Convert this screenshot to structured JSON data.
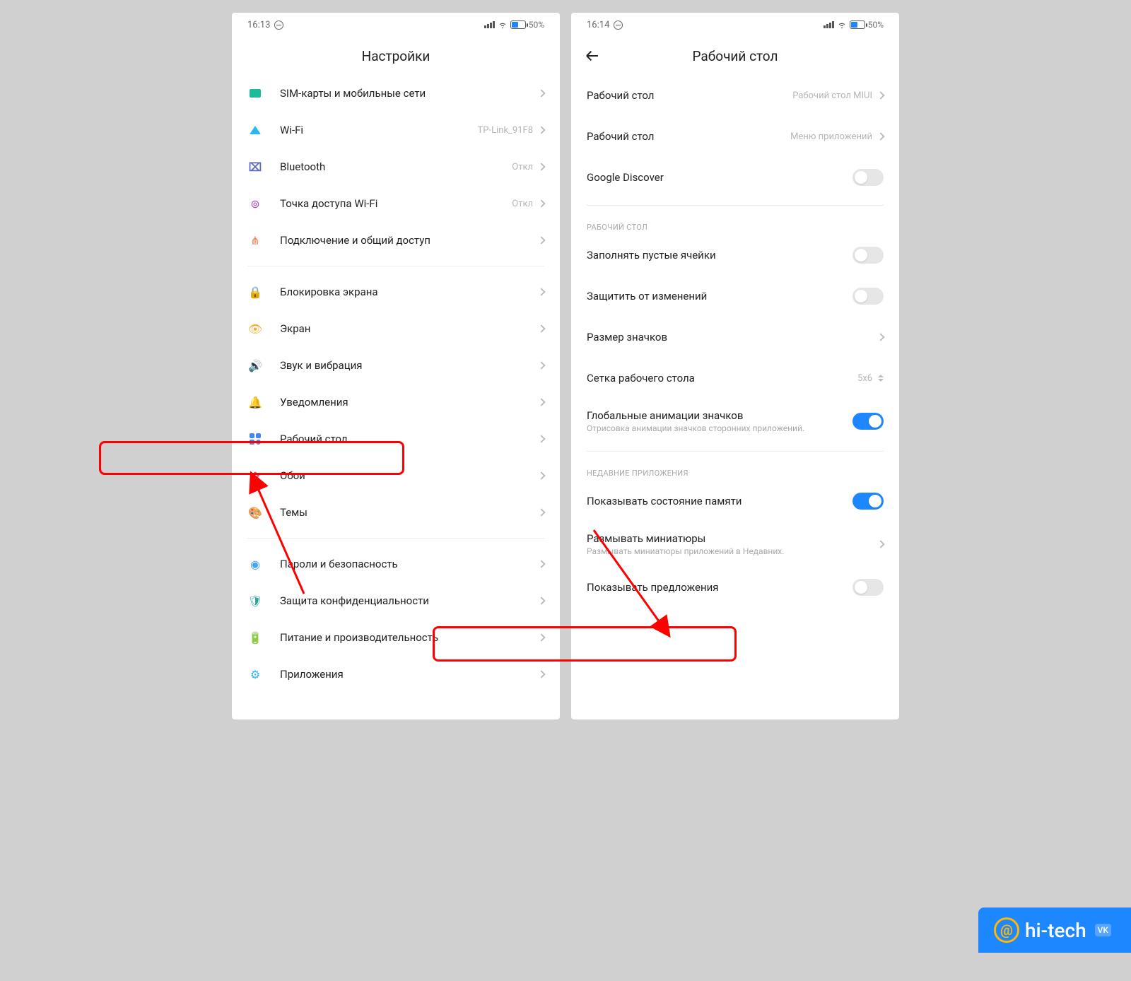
{
  "left": {
    "status": {
      "time": "16:13",
      "battery": "50%"
    },
    "title": "Настройки",
    "rows": [
      {
        "icon": "sim",
        "label": "SIM-карты и мобильные сети",
        "value": ""
      },
      {
        "icon": "wifi",
        "label": "Wi-Fi",
        "value": "TP-Link_91F8"
      },
      {
        "icon": "bt",
        "label": "Bluetooth",
        "value": "Откл"
      },
      {
        "icon": "hotspot",
        "label": "Точка доступа Wi-Fi",
        "value": "Откл"
      },
      {
        "icon": "share",
        "label": "Подключение и общий доступ",
        "value": ""
      }
    ],
    "rows2": [
      {
        "icon": "lock",
        "label": "Блокировка экрана"
      },
      {
        "icon": "eye",
        "label": "Экран"
      },
      {
        "icon": "sound",
        "label": "Звук и вибрация"
      },
      {
        "icon": "bell",
        "label": "Уведомления"
      },
      {
        "icon": "home",
        "label": "Рабочий стол",
        "highlight": true
      },
      {
        "icon": "wall",
        "label": "Обои"
      },
      {
        "icon": "theme",
        "label": "Темы"
      }
    ],
    "rows3": [
      {
        "icon": "fp",
        "label": "Пароли и безопасность"
      },
      {
        "icon": "shield",
        "label": "Защита конфиденциальности"
      },
      {
        "icon": "batt",
        "label": "Питание и производительность"
      },
      {
        "icon": "apps",
        "label": "Приложения"
      }
    ]
  },
  "right": {
    "status": {
      "time": "16:14",
      "battery": "50%"
    },
    "title": "Рабочий стол",
    "top": [
      {
        "label": "Рабочий стол",
        "value": "Рабочий стол MIUI",
        "type": "nav"
      },
      {
        "label": "Рабочий стол",
        "value": "Меню приложений",
        "type": "nav"
      },
      {
        "label": "Google Discover",
        "type": "toggle",
        "on": false
      }
    ],
    "section1_title": "РАБОЧИЙ СТОЛ",
    "section1": [
      {
        "label": "Заполнять пустые ячейки",
        "type": "toggle",
        "on": false
      },
      {
        "label": "Защитить от изменений",
        "type": "toggle",
        "on": false
      },
      {
        "label": "Размер значков",
        "type": "nav"
      },
      {
        "label": "Сетка рабочего стола",
        "value": "5x6",
        "type": "stepper"
      },
      {
        "label": "Глобальные анимации значков",
        "sub": "Отрисовка анимации значков сторонних приложений.",
        "type": "toggle",
        "on": true
      }
    ],
    "section2_title": "НЕДАВНИЕ ПРИЛОЖЕНИЯ",
    "section2": [
      {
        "label": "Показывать состояние памяти",
        "type": "toggle",
        "on": true
      },
      {
        "label": "Размывать миниатюры",
        "sub": "Размывать миниатюры приложений в Недавних.",
        "type": "nav"
      },
      {
        "label": "Показывать предложения",
        "type": "toggle",
        "on": false,
        "highlight": true
      }
    ]
  },
  "watermark": "hi-tech"
}
